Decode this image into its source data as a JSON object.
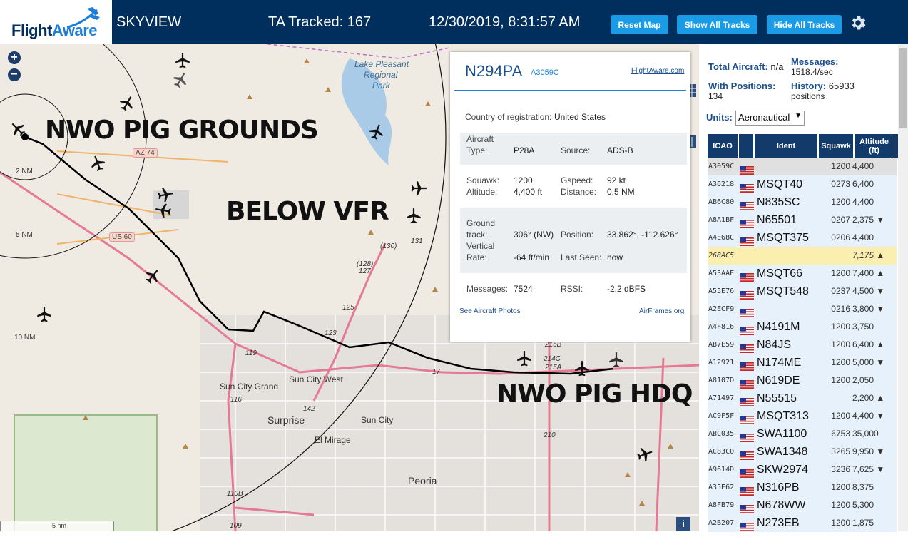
{
  "header": {
    "logo_prefix": "Flight",
    "logo_suffix": "Aware",
    "app_name": "SKYVIEW",
    "tracked": "TA Tracked: 167",
    "datetime": "12/30/2019, 8:31:57 AM",
    "reset_map": "Reset Map",
    "show_all": "Show All Tracks",
    "hide_all": "Hide All Tracks"
  },
  "map": {
    "zoom_in": "+",
    "zoom_out": "−",
    "annotations": {
      "grounds": "NWO PIG GROUNDS",
      "vfr": "BELOW VFR",
      "hdq": "NWO PIG HDQ"
    },
    "places": {
      "lake": "Lake Pleasant",
      "lake2": "Regional",
      "lake3": "Park",
      "sun_city_grand": "Sun City Grand",
      "sun_city_west": "Sun City West",
      "surprise": "Surprise",
      "sun_city": "Sun City",
      "el_mirage": "El Mirage",
      "peoria": "Peoria"
    },
    "rings": [
      "2 NM",
      "5 NM",
      "10 NM"
    ],
    "roads": {
      "az74": "AZ 74",
      "us60": "US 60",
      "r130": "(130)",
      "r131": "131",
      "r128": "(128)",
      "r127": "127",
      "r125": "125",
      "r123": "123",
      "r119": "119",
      "r116": "116",
      "r17": "17",
      "r142": "142",
      "r215b": "215B",
      "r214c": "214C",
      "r215a": "215A",
      "r210": "210",
      "r110b": "110B",
      "r109": "109"
    },
    "scale": "5 nm",
    "info": "i"
  },
  "popup": {
    "registration": "N294PA",
    "icao": "A3059C",
    "fa_link": "FlightAware.com",
    "country_label": "Country of registration:",
    "country": "United States",
    "aircraft_type_label": "Aircraft Type:",
    "aircraft_type_l1": "Aircraft",
    "aircraft_type_l2": "Type:",
    "aircraft_type": "P28A",
    "source_label": "Source:",
    "source": "ADS-B",
    "squawk_label": "Squawk:",
    "squawk": "1200",
    "gspeed_label": "Gspeed:",
    "gspeed": "92 kt",
    "altitude_label": "Altitude:",
    "altitude": "4,400 ft",
    "distance_label": "Distance:",
    "distance": "0.5 NM",
    "gt_l1": "Ground",
    "gt_l2": "track:",
    "ground_track": "306° (NW)",
    "position_label": "Position:",
    "position": "33.862°, -112.626°",
    "vr_l1": "Vertical",
    "vr_l2": "Rate:",
    "vertical_rate": "-64 ft/min",
    "last_seen_label": "Last Seen:",
    "last_seen": "now",
    "messages_label": "Messages:",
    "messages": "7524",
    "rssi_label": "RSSI:",
    "rssi": "-2.2 dBFS",
    "photos_link": "See Aircraft Photos",
    "airframes_link": "AirFrames.org"
  },
  "sidebar": {
    "total_label": "Total Aircraft:",
    "total_value": "n/a",
    "with_pos_label": "With Positions:",
    "with_pos_value": "134",
    "messages_label": "Messages:",
    "messages_value": "1518.4/sec",
    "history_label": "History:",
    "history_value": "65933",
    "history_unit": "positions",
    "units_label": "Units:",
    "units_value": "Aeronautical",
    "columns": [
      "ICAO",
      "Ident",
      "Squawk",
      "Altitude (ft)"
    ],
    "rows": [
      {
        "icao": "A3059C",
        "ident": "",
        "squawk": "1200",
        "alt": "4,400"
      },
      {
        "icao": "A36218",
        "ident": "MSQT40",
        "squawk": "0273",
        "alt": "6,400"
      },
      {
        "icao": "AB6C80",
        "ident": "N835SC",
        "squawk": "1200",
        "alt": "4,400"
      },
      {
        "icao": "A8A1BF",
        "ident": "N65501",
        "squawk": "0207",
        "alt": "2,375 ▼"
      },
      {
        "icao": "A4E68C",
        "ident": "MSQT375",
        "squawk": "0206",
        "alt": "4,400"
      },
      {
        "icao": "268AC5",
        "ident": "",
        "squawk": "",
        "alt": "7,175 ▲"
      },
      {
        "icao": "A53AAE",
        "ident": "MSQT66",
        "squawk": "1200",
        "alt": "7,400 ▲"
      },
      {
        "icao": "A55E76",
        "ident": "MSQT548",
        "squawk": "0237",
        "alt": "4,500 ▼"
      },
      {
        "icao": "A2ECF9",
        "ident": "",
        "squawk": "0216",
        "alt": "3,800 ▼"
      },
      {
        "icao": "A4F816",
        "ident": "N4191M",
        "squawk": "1200",
        "alt": "3,750"
      },
      {
        "icao": "AB7E59",
        "ident": "N84JS",
        "squawk": "1200",
        "alt": "6,400 ▲"
      },
      {
        "icao": "A12921",
        "ident": "N174ME",
        "squawk": "1200",
        "alt": "5,000 ▼"
      },
      {
        "icao": "A8107D",
        "ident": "N619DE",
        "squawk": "1200",
        "alt": "2,050"
      },
      {
        "icao": "A71497",
        "ident": "N55515",
        "squawk": "",
        "alt": "2,200 ▲"
      },
      {
        "icao": "AC9F5F",
        "ident": "MSQT313",
        "squawk": "1200",
        "alt": "4,400 ▼"
      },
      {
        "icao": "ABC035",
        "ident": "SWA1100",
        "squawk": "6753",
        "alt": "35,000"
      },
      {
        "icao": "AC83C0",
        "ident": "SWA1348",
        "squawk": "3265",
        "alt": "9,950 ▼"
      },
      {
        "icao": "A9614D",
        "ident": "SKW2974",
        "squawk": "3236",
        "alt": "7,625 ▼"
      },
      {
        "icao": "A35E62",
        "ident": "N316PB",
        "squawk": "1200",
        "alt": "8,375"
      },
      {
        "icao": "A8FB79",
        "ident": "N678WW",
        "squawk": "1200",
        "alt": "5,300"
      },
      {
        "icao": "A2B207",
        "ident": "N273EB",
        "squawk": "1200",
        "alt": "1,875"
      }
    ]
  },
  "colors": {
    "header_bg": "#002f5d",
    "button": "#1b9ae6",
    "selected_row": "#e0e0e0",
    "highlight_row": "#fbefb0",
    "row_bg": "#e6f1fb"
  }
}
